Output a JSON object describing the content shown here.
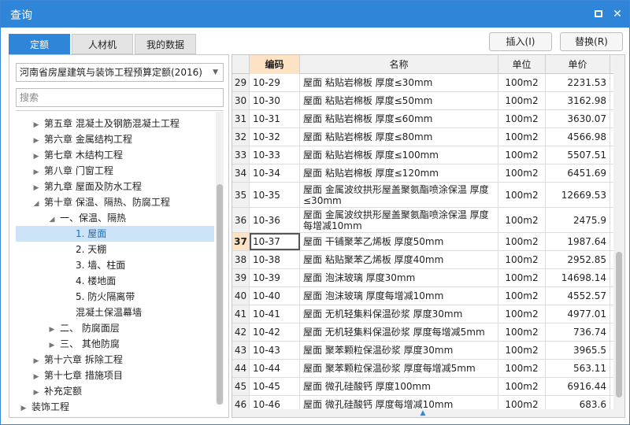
{
  "window": {
    "title": "查询"
  },
  "tabs": [
    {
      "label": "定额",
      "active": true
    },
    {
      "label": "人材机",
      "active": false
    },
    {
      "label": "我的数据",
      "active": false
    }
  ],
  "actions": {
    "insert": "插入(I)",
    "replace": "替换(R)"
  },
  "left": {
    "library": "河南省房屋建筑与装饰工程预算定额(2016)",
    "search_placeholder": "搜索",
    "tree": [
      {
        "label": "第五章 混凝土及钢筋混凝土工程",
        "level": 1,
        "arrow": "▶"
      },
      {
        "label": "第六章 金属结构工程",
        "level": 1,
        "arrow": "▶"
      },
      {
        "label": "第七章 木结构工程",
        "level": 1,
        "arrow": "▶"
      },
      {
        "label": "第八章 门窗工程",
        "level": 1,
        "arrow": "▶"
      },
      {
        "label": "第九章 屋面及防水工程",
        "level": 1,
        "arrow": "▶"
      },
      {
        "label": "第十章 保温、隔热、防腐工程",
        "level": 1,
        "arrow": "◢"
      },
      {
        "label": "一、保温、隔热",
        "level": 2,
        "arrow": "◢"
      },
      {
        "label": "1. 屋面",
        "level": 3,
        "arrow": "",
        "selected": true
      },
      {
        "label": "2. 天棚",
        "level": 3,
        "arrow": ""
      },
      {
        "label": "3. 墙、柱面",
        "level": 3,
        "arrow": ""
      },
      {
        "label": "4. 楼地面",
        "level": 3,
        "arrow": ""
      },
      {
        "label": "5. 防火隔离带",
        "level": 3,
        "arrow": ""
      },
      {
        "label": "混凝土保温幕墙",
        "level": 3,
        "arrow": ""
      },
      {
        "label": "二、 防腐面层",
        "level": 2,
        "arrow": "▶"
      },
      {
        "label": "三、 其他防腐",
        "level": 2,
        "arrow": "▶"
      },
      {
        "label": "第十六章 拆除工程",
        "level": 1,
        "arrow": "▶"
      },
      {
        "label": "第十七章 措施项目",
        "level": 1,
        "arrow": "▶"
      },
      {
        "label": "补充定额",
        "level": 1,
        "arrow": "▶"
      },
      {
        "label": "装饰工程",
        "level": 0,
        "arrow": "▶"
      }
    ]
  },
  "grid": {
    "columns": {
      "num": "",
      "code": "编码",
      "name": "名称",
      "unit": "单位",
      "price": "单价"
    },
    "rows": [
      {
        "num": "29",
        "code": "10-29",
        "name": "屋面 粘贴岩棉板 厚度≤30mm",
        "unit": "100m2",
        "price": "2231.53"
      },
      {
        "num": "30",
        "code": "10-30",
        "name": "屋面 粘贴岩棉板 厚度≤50mm",
        "unit": "100m2",
        "price": "3162.98"
      },
      {
        "num": "31",
        "code": "10-31",
        "name": "屋面 粘贴岩棉板 厚度≤60mm",
        "unit": "100m2",
        "price": "3630.07"
      },
      {
        "num": "32",
        "code": "10-32",
        "name": "屋面 粘贴岩棉板 厚度≤80mm",
        "unit": "100m2",
        "price": "4566.98"
      },
      {
        "num": "33",
        "code": "10-33",
        "name": "屋面 粘贴岩棉板 厚度≤100mm",
        "unit": "100m2",
        "price": "5507.51"
      },
      {
        "num": "34",
        "code": "10-34",
        "name": "屋面 粘贴岩棉板 厚度≤120mm",
        "unit": "100m2",
        "price": "6451.69"
      },
      {
        "num": "35",
        "code": "10-35",
        "name": "屋面 金属波纹拱形屋盖聚氨酯喷涂保温 厚度≤30mm",
        "unit": "100m2",
        "price": "12669.53",
        "tall": true
      },
      {
        "num": "36",
        "code": "10-36",
        "name": "屋面 金属波纹拱形屋盖聚氨酯喷涂保温 厚度每增减10mm",
        "unit": "100m2",
        "price": "2475.9",
        "tall": true
      },
      {
        "num": "37",
        "code": "10-37",
        "name": "屋面 干铺聚苯乙烯板 厚度50mm",
        "unit": "100m2",
        "price": "1987.64",
        "current": true
      },
      {
        "num": "38",
        "code": "10-38",
        "name": "屋面 粘贴聚苯乙烯板 厚度40mm",
        "unit": "100m2",
        "price": "2952.85"
      },
      {
        "num": "39",
        "code": "10-39",
        "name": "屋面 泡沫玻璃 厚度30mm",
        "unit": "100m2",
        "price": "14698.14"
      },
      {
        "num": "40",
        "code": "10-40",
        "name": "屋面 泡沫玻璃 厚度每增减10mm",
        "unit": "100m2",
        "price": "4552.57"
      },
      {
        "num": "41",
        "code": "10-41",
        "name": "屋面 无机轻集料保温砂浆 厚度30mm",
        "unit": "100m2",
        "price": "4977.01"
      },
      {
        "num": "42",
        "code": "10-42",
        "name": "屋面 无机轻集料保温砂浆 厚度每增减5mm",
        "unit": "100m2",
        "price": "736.74"
      },
      {
        "num": "43",
        "code": "10-43",
        "name": "屋面 聚苯颗粒保温砂浆 厚度30mm",
        "unit": "100m2",
        "price": "3965.5"
      },
      {
        "num": "44",
        "code": "10-44",
        "name": "屋面 聚苯颗粒保温砂浆 厚度每增减5mm",
        "unit": "100m2",
        "price": "563.11"
      },
      {
        "num": "45",
        "code": "10-45",
        "name": "屋面 微孔硅酸钙 厚度100mm",
        "unit": "100m2",
        "price": "6916.44"
      },
      {
        "num": "46",
        "code": "10-46",
        "name": "屋面 微孔硅酸钙 厚度每增减10mm",
        "unit": "100m2",
        "price": "683.6"
      }
    ]
  }
}
